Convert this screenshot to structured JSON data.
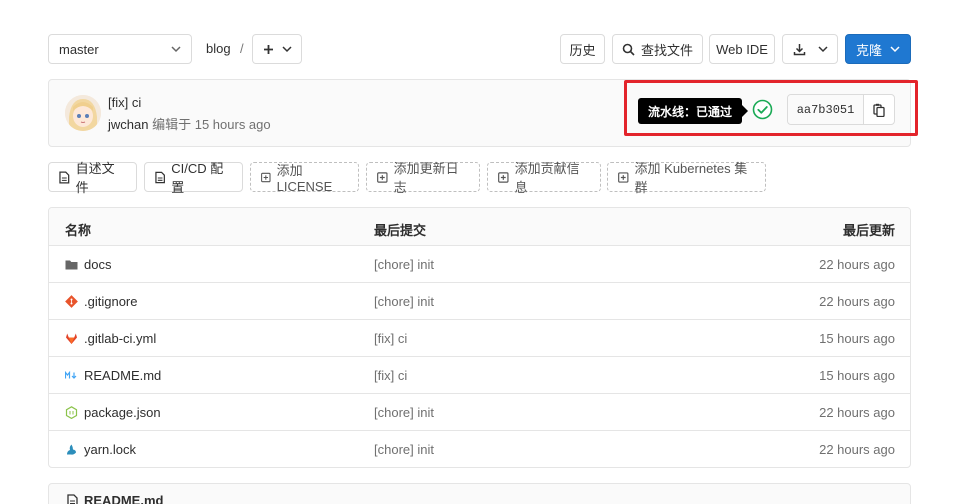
{
  "toolbar": {
    "branch": "master",
    "project": "blog",
    "separator": "/",
    "history": "历史",
    "find_file": "查找文件",
    "web_ide": "Web IDE",
    "clone": "克隆"
  },
  "commit": {
    "title": "[fix] ci",
    "author": "jwchan",
    "action": "编辑于",
    "time": "15 hours ago",
    "pipeline_tooltip": "流水线：已通过",
    "sha": "aa7b3051",
    "pipeline_status_color": "#1aaa55"
  },
  "quick_actions": {
    "readme": "自述文件",
    "cicd": "CI/CD 配置",
    "license": "添加LICENSE",
    "changelog": "添加更新日志",
    "contributing": "添加贡献信息",
    "kubernetes": "添加 Kubernetes 集群"
  },
  "table": {
    "headers": {
      "name": "名称",
      "last_commit": "最后提交",
      "last_update": "最后更新"
    },
    "rows": [
      {
        "name": "docs",
        "icon": "folder-icon",
        "message": "[chore] init",
        "time": "22 hours ago"
      },
      {
        "name": ".gitignore",
        "icon": "git-icon",
        "message": "[chore] init",
        "time": "22 hours ago"
      },
      {
        "name": ".gitlab-ci.yml",
        "icon": "gitlab-icon",
        "message": "[fix] ci",
        "time": "15 hours ago"
      },
      {
        "name": "README.md",
        "icon": "markdown-icon",
        "message": "[fix] ci",
        "time": "15 hours ago"
      },
      {
        "name": "package.json",
        "icon": "nodejs-icon",
        "message": "[chore] init",
        "time": "22 hours ago"
      },
      {
        "name": "yarn.lock",
        "icon": "yarn-icon",
        "message": "[chore] init",
        "time": "22 hours ago"
      }
    ]
  },
  "readme_panel": {
    "title": "README.md"
  },
  "colors": {
    "primary": "#1f78d1",
    "highlight_border": "#e3242b",
    "success": "#1aaa55"
  }
}
